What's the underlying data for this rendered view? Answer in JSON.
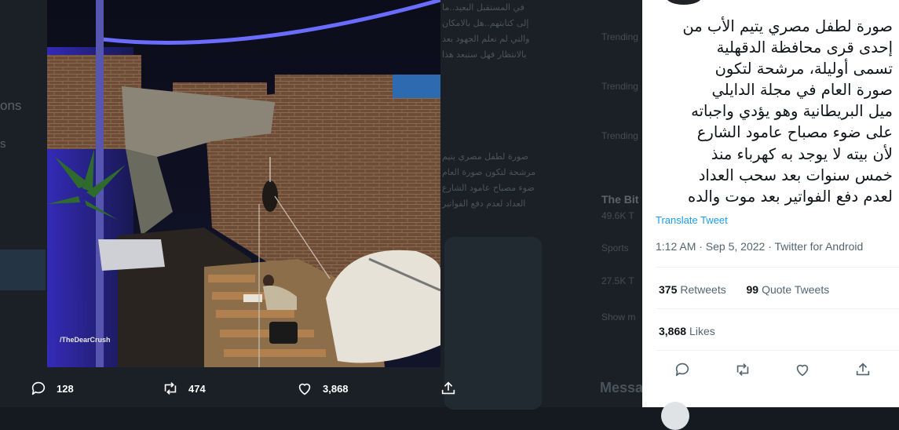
{
  "background": {
    "left_text_1": "ons",
    "left_text_2": "s",
    "arabic_snippet_1": [
      "في المستقبل البعيد..ما",
      "إلى كتابتهم..هل بالامكان",
      "والتي لم تعلم الجهود بعد",
      "بالانتظار فهل ستبعد هذا"
    ],
    "arabic_snippet_2": [
      "صورة لطفل مصري يتيم",
      "مرشحة لتكون صورة العام",
      "ضوء مصباح عامود الشارع",
      "العداد لعدم دفع الفواتير"
    ],
    "trend_labels": [
      "Trending",
      "Trending",
      "Trending"
    ],
    "trend_title": "The Bit",
    "trend_count": "49.6K T",
    "trend_sports": "Sports",
    "trend_count2": "27.5K T",
    "trend_show": "Show m",
    "messages": "Messa"
  },
  "photo": {
    "watermark": "/TheDearCrush"
  },
  "photo_actions": {
    "replies": "128",
    "retweets": "474",
    "likes": "3,868"
  },
  "tweet": {
    "text_lines": [
      "صورة لطفل مصري يتيم الأب من",
      "إحدى قرى محافظة الدقهلية",
      "تسمى أوليلة، مرشحة لتكون",
      "صورة العام في مجلة الدايلي",
      "ميل البريطانية وهو يؤدي واجباته",
      "على ضوء مصباح عامود الشارع",
      "لأن بيته لا يوجد به كهرباء منذ",
      "خمس سنوات بعد سحب العداد",
      "لعدم دفع الفواتير بعد موت والده"
    ],
    "translate": "Translate Tweet",
    "meta": "1:12 AM · Sep 5, 2022 · Twitter for Android",
    "retweets_count": "375",
    "retweets_label": "Retweets",
    "quotes_count": "99",
    "quotes_label": "Quote Tweets",
    "likes_count": "3,868",
    "likes_label": "Likes"
  },
  "colors": {
    "accent": "#1d9bf0",
    "text": "#0f1419",
    "muted": "#536471"
  }
}
